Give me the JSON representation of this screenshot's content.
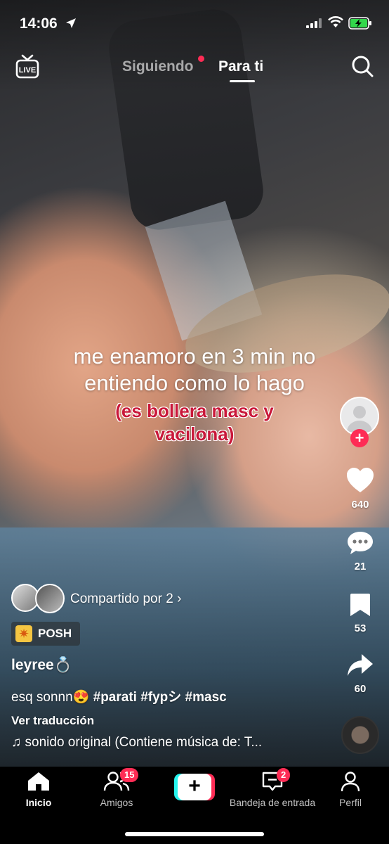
{
  "status_bar": {
    "time": "14:06"
  },
  "top_nav": {
    "tabs": [
      {
        "label": "Siguiendo",
        "active": false,
        "has_dot": true
      },
      {
        "label": "Para ti",
        "active": true
      }
    ],
    "live_label": "LIVE"
  },
  "video": {
    "caption_main": "me enamoro en 3 min no entiendo como lo hago",
    "caption_sub": "(es bollera masc y vacilona)"
  },
  "actions": {
    "likes": "640",
    "comments": "21",
    "saves": "53",
    "shares": "60"
  },
  "post": {
    "shared_by": "Compartido por 2",
    "badge": "POSH",
    "username": "leyree💍",
    "description_text": "esq sonnn😍",
    "hashtags": "#parati #fypシ #masc",
    "translate": "Ver traducción",
    "sound": "sonido original (Contiene música de: T..."
  },
  "bottom_nav": {
    "items": [
      {
        "label": "Inicio",
        "active": true
      },
      {
        "label": "Amigos",
        "badge": "15"
      },
      {
        "label": "Bandeja de entrada",
        "badge": "2"
      },
      {
        "label": "Perfil"
      }
    ]
  },
  "colors": {
    "accent": "#fe2c55",
    "cyan": "#25f4ee",
    "caption_sub": "#c9183a"
  }
}
